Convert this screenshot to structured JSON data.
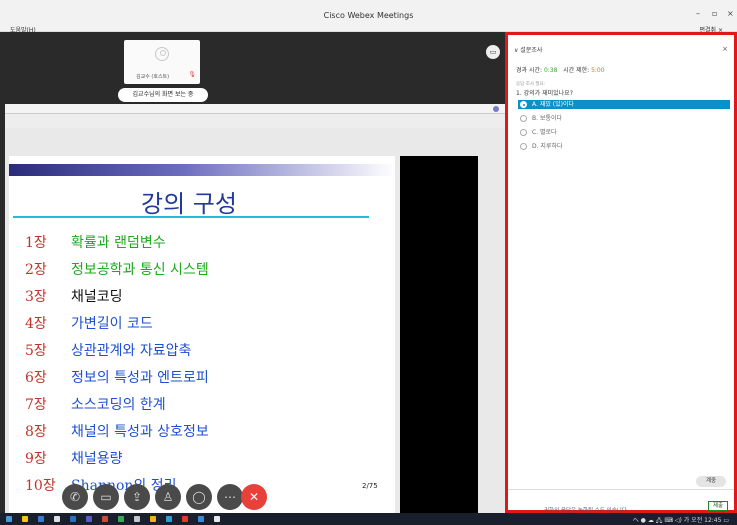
{
  "window": {
    "title": "Cisco Webex Meetings",
    "menu_help": "도움말(H)",
    "view_label": "편결취 ×",
    "minimize": "–",
    "maximize": "▫",
    "close": "×"
  },
  "stage": {
    "participant_name": "김교수 (호스트)",
    "viewing_text": "김교수님의 화면 보는 중"
  },
  "slide": {
    "title": "강의 구성",
    "page": "2/75",
    "chapters": [
      {
        "num": "1장",
        "text": "확률과 랜덤변수",
        "color": "#1ea91e"
      },
      {
        "num": "2장",
        "text": "정보공학과 통신 시스템",
        "color": "#1ea91e"
      },
      {
        "num": "3장",
        "text": "채널코딩",
        "color": "#111111"
      },
      {
        "num": "4장",
        "text": "가변길이 코드",
        "color": "#1e4fd0"
      },
      {
        "num": "5장",
        "text": "상관관계와 자료압축",
        "color": "#1e4fd0"
      },
      {
        "num": "6장",
        "text": "정보의 특성과 엔트로피",
        "color": "#1e4fd0"
      },
      {
        "num": "7장",
        "text": "소스코딩의 한계",
        "color": "#1e4fd0"
      },
      {
        "num": "8장",
        "text": "채널의 특성과 상호정보",
        "color": "#1e4fd0"
      },
      {
        "num": "9장",
        "text": "채널용량",
        "color": "#1e4fd0"
      },
      {
        "num": "10장",
        "text": "Shannon의 정리",
        "color": "#1e4fd0"
      }
    ]
  },
  "controls": {
    "phone": "✆",
    "video": "▭",
    "share": "⇪",
    "participants": "♙",
    "chat": "◯",
    "more": "⋯",
    "end": "✕"
  },
  "survey": {
    "header": "∨ 설문조사",
    "close_x": "×",
    "elapsed_label": "경과 시간:",
    "elapsed_value": "0:38",
    "limit_label": "시간 제한:",
    "limit_value": "5:00",
    "note": "응답 조사 필요:",
    "question": "1. 강의가 재미있나요?",
    "options": [
      {
        "label": "A. 재밌 (있)이다",
        "selected": true
      },
      {
        "label": "B. 보통이다",
        "selected": false
      },
      {
        "label": "C. 별로다",
        "selected": false
      },
      {
        "label": "D. 지루하다",
        "selected": false
      }
    ],
    "close_button": "계중",
    "notice": "귀하의 응답은 녹화될 수도 있습니다.",
    "submit": "제출"
  },
  "taskbar": {
    "tray_text": "へ ● ☁ 🖧 ⌨ ◁) 가  오전 12:45  ▭"
  }
}
